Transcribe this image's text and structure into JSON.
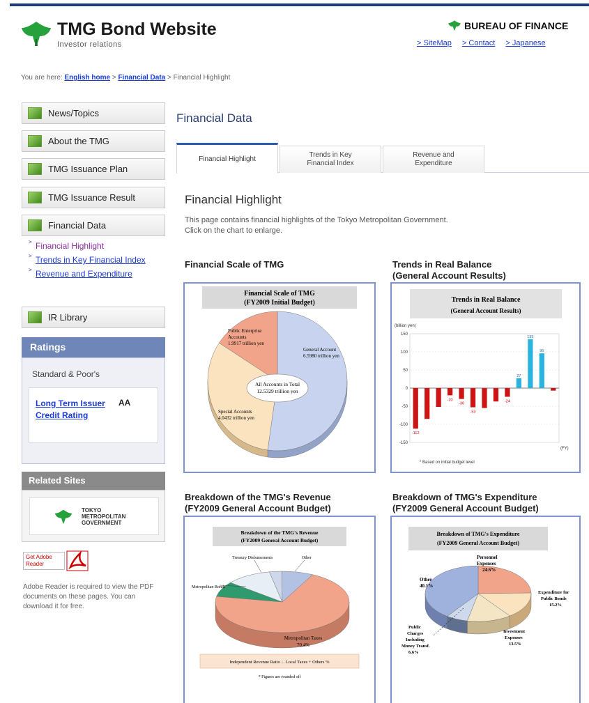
{
  "header": {
    "title": "TMG Bond Website",
    "subtitle": "Investor relations",
    "bureau": "BUREAU OF FINANCE",
    "links": [
      "SiteMap",
      "Contact",
      "Japanese"
    ]
  },
  "breadcrumb": {
    "prefix": "You are here:",
    "home": "English home",
    "section": "Financial Data",
    "current": "> Financial Highlight"
  },
  "sidebar": {
    "items": [
      {
        "label": "News/Topics"
      },
      {
        "label": "About the TMG"
      },
      {
        "label": "TMG Issuance Plan"
      },
      {
        "label": "TMG Issuance Result"
      },
      {
        "label": "Financial Data"
      },
      {
        "label": "IR Library"
      }
    ],
    "sublinks": [
      "Financial Highlight",
      "Trends in Key Financial Index",
      "Revenue and Expenditure"
    ],
    "ratings": {
      "heading": "Ratings",
      "agency": "Standard & Poor's",
      "label": "Long Term Issuer Credit Rating",
      "value": "AA"
    },
    "related": {
      "heading": "Related Sites",
      "gov_text": "TOKYO\nMETROPOLITAN\nGOVERNMENT"
    },
    "adobe": {
      "badge": "Get Adobe Reader",
      "note": "Adobe Reader is required to view the PDF documents on these pages. You can download it for free."
    }
  },
  "main": {
    "page_title": "Financial Data",
    "tabs": [
      "Financial Highlight",
      "Trends in Key Financial Index",
      "Revenue and Expenditure"
    ],
    "section_title": "Financial Highlight",
    "intro_line1": "This page contains financial highlights of the Tokyo Metropolitan Government.",
    "intro_line2": "Click on the chart to enlarge."
  },
  "charts": {
    "c1_caption": "Financial Scale of TMG",
    "c2_caption_1": "Trends in Real Balance",
    "c2_caption_2": "(General Account Results)",
    "c3_caption_1": "Breakdown of the TMG's Revenue",
    "c3_caption_2": "(FY2009 General Account Budget)",
    "c4_caption_1": "Breakdown of TMG's Expenditure",
    "c4_caption_2": "(FY2009 General Account Budget)",
    "c1_title_1": "Financial Scale of TMG",
    "c1_title_2": "(FY2009 Initial Budget)",
    "c1_center_1": "All Accounts in Total",
    "c1_center_2": "12.5329 trillion yen",
    "c1_general_1": "General Account",
    "c1_general_2": "6.5980 trillion yen",
    "c1_public_1": "Public Enterprise",
    "c1_public_2": "Accounts",
    "c1_public_3": "1.9917 trillion yen",
    "c1_special_1": "Special Accounts",
    "c1_special_2": "4.0432 trillion yen",
    "c2_title_1": "Trends in Real Balance",
    "c2_title_2": "(General Account Results)",
    "c2_unit": "(billion yen)",
    "c2_note": "* Based on initial budget level",
    "c2_fy": "(FY)",
    "c3_title_1": "Breakdown of the TMG's Revenue",
    "c3_title_2": "(FY2009 General Account Budget)",
    "c3_tax_1": "Metropolitan Taxes",
    "c3_tax_2": "70.4%",
    "c3_bonds": "Metropolitan Bonds",
    "c3_other": "Other",
    "c3_treasury": "Treasury Disbursements",
    "c3_footer_1": "Independent Revenue Ratio ... Local Taxes + Others %",
    "c3_footer_2": "* Figures are rounded off",
    "c4_title_1": "Breakdown of TMG's Expenditure",
    "c4_title_2": "(FY2009 General Account Budget)",
    "c4_personnel_1": "Personnel",
    "c4_personnel_2": "Expenses",
    "c4_personnel_3": "24.6%",
    "c4_other_1": "Other",
    "c4_other_2": "40.1%",
    "c4_debt_1": "Expenditure for",
    "c4_debt_2": "Public Bonds",
    "c4_debt_3": "15.2%",
    "c4_invest_1": "Investment",
    "c4_invest_2": "Expenses",
    "c4_invest_3": "13.5%",
    "c4_transfer_1": "Public",
    "c4_transfer_2": "Charges",
    "c4_transfer_3": "Including",
    "c4_transfer_4": "Money Transf.",
    "c4_transfer_5": "6.6%"
  },
  "chart_data": [
    {
      "type": "pie",
      "title": "Financial Scale of TMG (FY2009 Initial Budget)",
      "categories": [
        "General Account",
        "Special Accounts",
        "Public Enterprise Accounts"
      ],
      "values": [
        6.598,
        4.0432,
        1.9917
      ]
    },
    {
      "type": "bar",
      "title": "Trends in Real Balance (General Account Results)",
      "ylabel": "(billion yen)",
      "ylim": [
        -150,
        150
      ],
      "grid": true,
      "values": [
        -112,
        -85,
        -52,
        -20,
        -30,
        -53,
        -55,
        -37,
        -24,
        27,
        135,
        96,
        -7
      ],
      "labels": [
        -112,
        null,
        null,
        -20,
        -30,
        -53,
        null,
        null,
        -24,
        27,
        135,
        96,
        null
      ]
    },
    {
      "type": "pie",
      "title": "Breakdown of the TMG's Revenue (FY2009 General Account Budget)",
      "categories": [
        "Metropolitan Taxes",
        "Metropolitan Bonds",
        "Other",
        "Treasury Disbursements",
        "Others"
      ],
      "values": [
        70.4,
        8,
        11,
        3,
        7.6
      ]
    },
    {
      "type": "pie",
      "title": "Breakdown of TMG's Expenditure (FY2009 General Account Budget)",
      "categories": [
        "Personnel Expenses",
        "Expenditure for Public Bonds",
        "Investment Expenses",
        "Public Charges Including Money Transf.",
        "Other"
      ],
      "values": [
        24.6,
        15.2,
        13.5,
        6.6,
        40.1
      ]
    }
  ],
  "colors": {
    "accent": "#1e3a7e",
    "link": "#1a3bd6",
    "chart_border": "#7f93d4",
    "negative_bar": "#cc1414",
    "positive_bar": "#2cb3dd"
  }
}
